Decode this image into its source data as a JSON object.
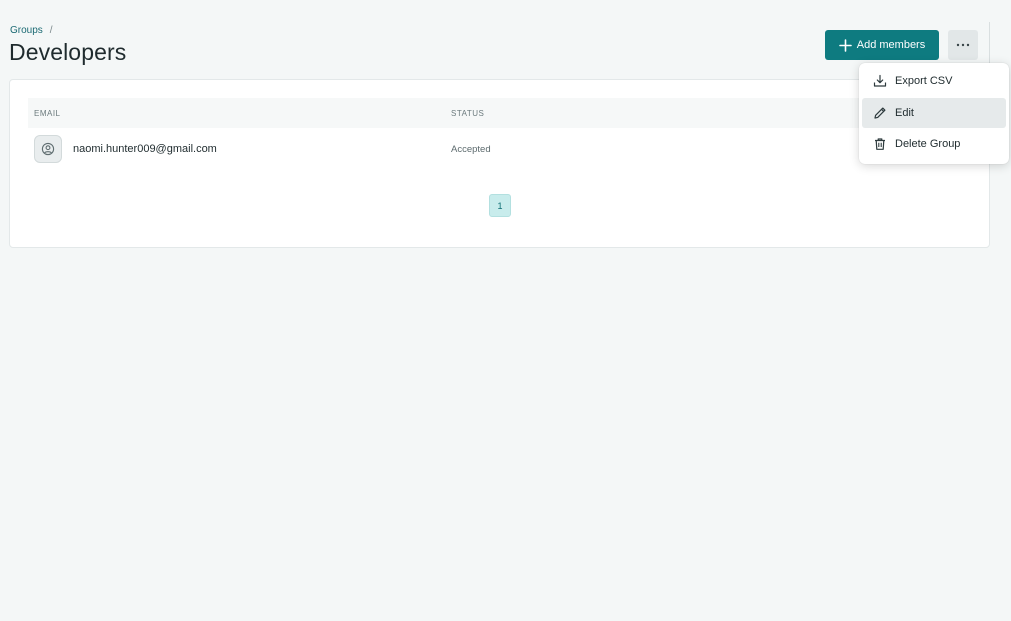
{
  "breadcrumb": {
    "parent": "Groups",
    "separator": "/"
  },
  "page": {
    "title": "Developers"
  },
  "toolbar": {
    "add_members_label": "Add members",
    "more_icon": "more-horizontal-icon"
  },
  "table": {
    "columns": [
      "EMAIL",
      "STATUS"
    ],
    "rows": [
      {
        "email": "naomi.hunter009@gmail.com",
        "status": "Accepted",
        "avatar_icon": "user-circle-icon"
      }
    ]
  },
  "pagination": {
    "current_page": "1"
  },
  "menu": {
    "items": [
      {
        "label": "Export CSV",
        "icon": "download-icon"
      },
      {
        "label": "Edit",
        "icon": "pencil-icon",
        "highlighted": true
      },
      {
        "label": "Delete Group",
        "icon": "trash-icon"
      }
    ]
  },
  "colors": {
    "primary": "#0e7b80",
    "background": "#f4f7f7",
    "pagination_active": "#c8ecec"
  }
}
